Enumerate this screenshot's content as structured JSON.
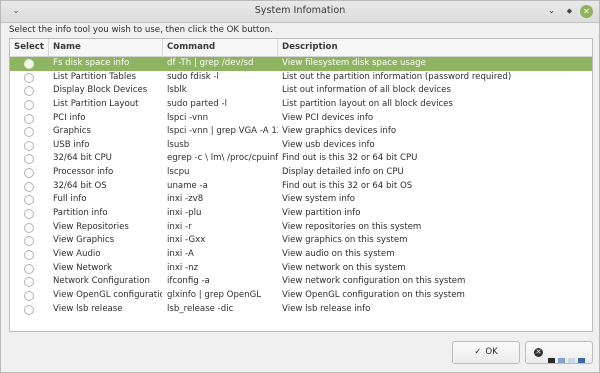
{
  "window": {
    "title": "System Infomation",
    "menu_glyph": "⌄",
    "minimize_glyph": "⌄",
    "maximize_glyph": "◆",
    "close_glyph": "✕"
  },
  "prompt": "Select the info tool you wish to use, then click the OK button.",
  "table": {
    "headers": {
      "select": "Select",
      "name": "Name",
      "command": "Command",
      "description": "Description"
    },
    "rows": [
      {
        "name": "Fs disk space info",
        "command": "df -Th | grep /dev/sd",
        "description": "View filesystem disk space usage",
        "selected": true
      },
      {
        "name": "List Partition Tables",
        "command": "sudo fdisk -l",
        "description": "List out the partition information (password required)",
        "selected": false
      },
      {
        "name": "Display Block Devices",
        "command": "lsblk",
        "description": "List out information of all block devices",
        "selected": false
      },
      {
        "name": "List Partition Layout",
        "command": "sudo parted -l",
        "description": "List partition layout on all block devices",
        "selected": false
      },
      {
        "name": "PCI info",
        "command": "lspci -vnn",
        "description": "View PCI devices info",
        "selected": false
      },
      {
        "name": "Graphics",
        "command": "lspci -vnn | grep VGA -A 12",
        "description": "View graphics devices info",
        "selected": false
      },
      {
        "name": "USB info",
        "command": "lsusb",
        "description": "View usb devices info",
        "selected": false
      },
      {
        "name": "32/64 bit CPU",
        "command": "egrep -c \\ lm\\ /proc/cpuinfo",
        "description": "Find out is this 32 or 64 bit CPU",
        "selected": false
      },
      {
        "name": "Processor info",
        "command": "lscpu",
        "description": "Display detailed info on CPU",
        "selected": false
      },
      {
        "name": "32/64 bit OS",
        "command": "uname -a",
        "description": "Find out is this 32 or 64 bit OS",
        "selected": false
      },
      {
        "name": "Full info",
        "command": "inxi -zv8",
        "description": "View system info",
        "selected": false
      },
      {
        "name": "Partition info",
        "command": "inxi -plu",
        "description": "View partition info",
        "selected": false
      },
      {
        "name": "View Repositories",
        "command": "inxi -r",
        "description": "View repositories on this system",
        "selected": false
      },
      {
        "name": "View Graphics",
        "command": "inxi -Gxx",
        "description": "View graphics on this system",
        "selected": false
      },
      {
        "name": "View Audio",
        "command": "inxi -A",
        "description": "View audio on this system",
        "selected": false
      },
      {
        "name": "View Network",
        "command": "inxi -nz",
        "description": "View network on this system",
        "selected": false
      },
      {
        "name": "Network Configuration",
        "command": "ifconfig -a",
        "description": "View network  configuration on this system",
        "selected": false
      },
      {
        "name": "View OpenGL configuration",
        "command": "glxinfo | grep OpenGL",
        "description": "View OpenGL configuration on this system",
        "selected": false
      },
      {
        "name": "View lsb release",
        "command": "lsb_release -dic",
        "description": "View lsb release info",
        "selected": false
      }
    ]
  },
  "buttons": {
    "ok_label": "OK",
    "ok_icon": "check-icon",
    "cancel_icon": "cancel-icon",
    "cancel_colors": [
      "#2b2b2b",
      "#7fa3c9",
      "#c8d6e6",
      "#3c6aa0"
    ]
  },
  "colors": {
    "selected_row": "#8eb461",
    "close_button": "#8fb35c"
  }
}
